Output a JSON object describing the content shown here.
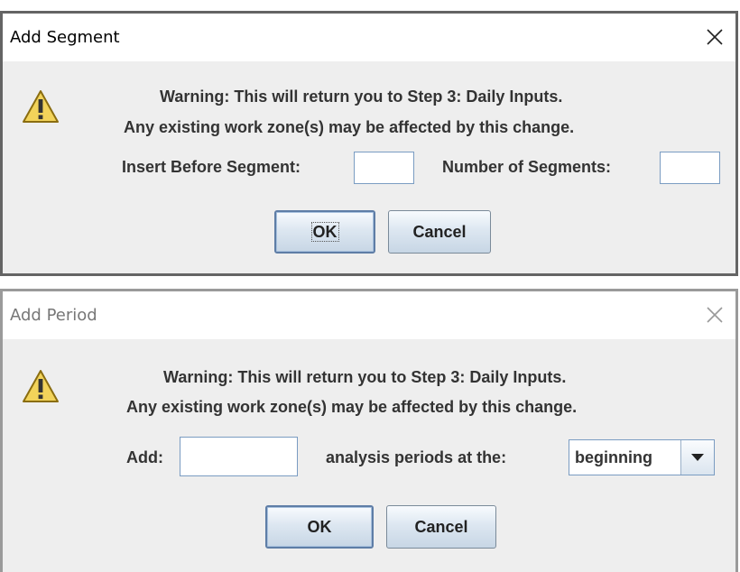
{
  "dialog1": {
    "title": "Add Segment",
    "warning_line1": "Warning: This will return you to Step 3: Daily Inputs.",
    "warning_line2": "Any existing work zone(s) may be affected by this change.",
    "insert_before_label": "Insert Before Segment:",
    "insert_before_value": "",
    "num_segments_label": "Number of Segments:",
    "num_segments_value": "",
    "ok_label": "OK",
    "cancel_label": "Cancel"
  },
  "dialog2": {
    "title": "Add Period",
    "warning_line1": "Warning: This will return you to Step 3: Daily Inputs.",
    "warning_line2": "Any existing work zone(s) may be affected by this change.",
    "add_label": "Add:",
    "add_value": "",
    "periods_label": "analysis periods at the:",
    "position_selected": "beginning",
    "ok_label": "OK",
    "cancel_label": "Cancel"
  },
  "icons": {
    "warning": "warning-triangle-icon",
    "close": "close-icon",
    "dropdown": "triangle-down-icon"
  },
  "colors": {
    "dialog_bg": "#eeeeee",
    "titlebar_bg": "#ffffff",
    "warning_yellow": "#f2d35a",
    "text": "#333333"
  }
}
